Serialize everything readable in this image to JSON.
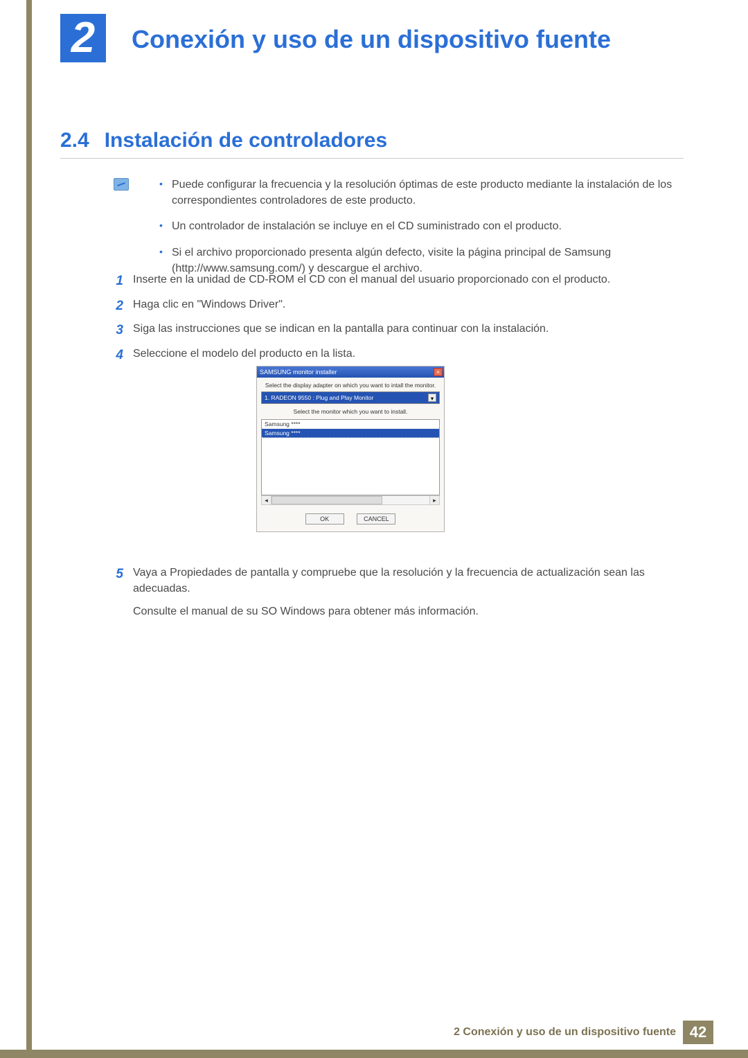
{
  "chapter": {
    "number": "2",
    "title": "Conexión y uso de un dispositivo fuente"
  },
  "section": {
    "number": "2.4",
    "title": "Instalación de controladores"
  },
  "notes": [
    "Puede configurar la frecuencia y la resolución óptimas de este producto mediante la instalación de los correspondientes controladores de este producto.",
    "Un controlador de instalación se incluye en el CD suministrado con el producto.",
    "Si el archivo proporcionado presenta algún defecto, visite la página principal de Samsung (http://www.samsung.com/) y descargue el archivo."
  ],
  "steps": [
    "Inserte en la unidad de CD-ROM el CD con el manual del usuario proporcionado con el producto.",
    "Haga clic en \"Windows Driver\".",
    "Siga las instrucciones que se indican en la pantalla para continuar con la instalación.",
    "Seleccione el modelo del producto en la lista."
  ],
  "step5": {
    "num": "5",
    "text": "Vaya a Propiedades de pantalla y compruebe que la resolución y la frecuencia de actualización sean las adecuadas.",
    "text2": "Consulte el manual de su SO Windows para obtener más información."
  },
  "installer": {
    "title": "SAMSUNG monitor installer",
    "label1": "Select the display adapter on which you want to intall the monitor.",
    "adapter": "1. RADEON 9550 : Plug and Play Monitor",
    "label2": "Select the monitor which you want to install.",
    "items": [
      "Samsung ****",
      "Samsung ****"
    ],
    "ok": "OK",
    "cancel": "CANCEL"
  },
  "footer": {
    "text": "2 Conexión y uso de un dispositivo fuente",
    "page": "42"
  }
}
